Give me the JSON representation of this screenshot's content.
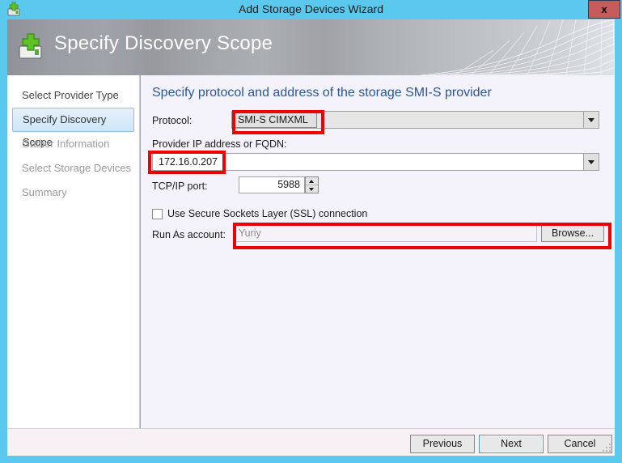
{
  "window": {
    "title": "Add Storage Devices Wizard",
    "icon": "add-storage-device-icon",
    "close_label": "x",
    "titlebar_color": "#5bc8ee"
  },
  "banner": {
    "title": "Specify Discovery Scope",
    "icon": "add-storage-device-icon"
  },
  "sidebar": {
    "items": [
      {
        "label": "Select Provider Type",
        "state": "completed"
      },
      {
        "label": "Specify Discovery Scope",
        "state": "selected"
      },
      {
        "label": "Gather Information",
        "state": "disabled"
      },
      {
        "label": "Select Storage Devices",
        "state": "disabled"
      },
      {
        "label": "Summary",
        "state": "disabled"
      }
    ]
  },
  "content": {
    "heading": "Specify protocol and address of the storage SMI-S provider",
    "protocol": {
      "label": "Protocol:",
      "value": "SMI-S CIMXML"
    },
    "provider_address": {
      "label": "Provider IP address or FQDN:",
      "value": "172.16.0.207"
    },
    "tcp_port": {
      "label": "TCP/IP port:",
      "value": "5988"
    },
    "ssl": {
      "label": "Use Secure Sockets Layer (SSL) connection",
      "checked": false
    },
    "run_as": {
      "label": "Run As account:",
      "value": "Yuriy",
      "browse_label": "Browse..."
    }
  },
  "footer": {
    "previous_label": "Previous",
    "next_label": "Next",
    "cancel_label": "Cancel"
  },
  "annotations": {
    "color": "#ee0000",
    "count": 3
  }
}
